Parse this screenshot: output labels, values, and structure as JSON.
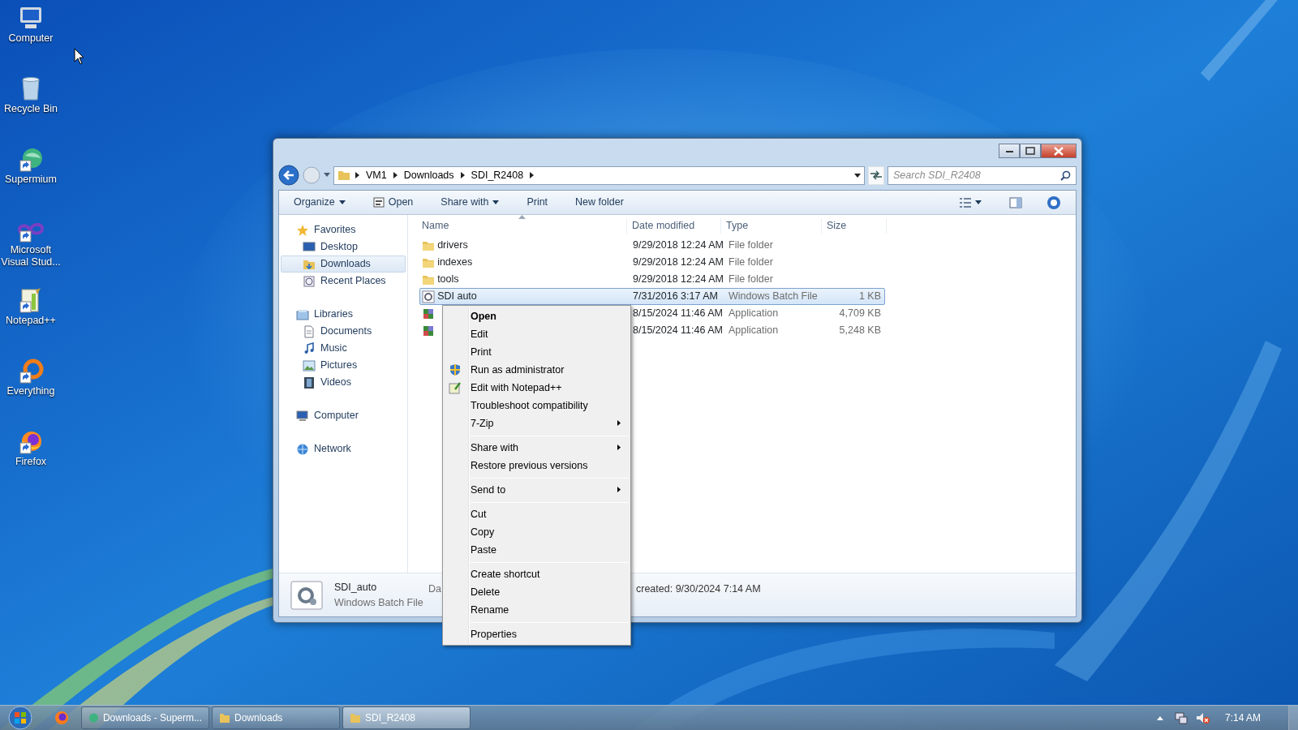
{
  "desktop_icons": [
    {
      "label": "Computer",
      "kind": "computer"
    },
    {
      "label": "Recycle Bin",
      "kind": "bin"
    },
    {
      "label": "Supermium",
      "kind": "sphere"
    },
    {
      "label": "Microsoft Visual Stud...",
      "kind": "infinity"
    },
    {
      "label": "Notepad++",
      "kind": "editor"
    },
    {
      "label": "Everything",
      "kind": "ring"
    },
    {
      "label": "Firefox",
      "kind": "fox"
    }
  ],
  "window": {
    "address": {
      "breadcrumb": [
        "VM1",
        "Downloads",
        "SDI_R2408"
      ]
    },
    "search": {
      "placeholder": "Search SDI_R2408"
    },
    "toolbar": [
      {
        "label": "Organize",
        "kind": "menu"
      },
      {
        "label": "Open",
        "kind": "open"
      },
      {
        "label": "Share with",
        "kind": "menu"
      },
      {
        "label": "Print",
        "kind": "plain"
      },
      {
        "label": "New folder",
        "kind": "plain"
      }
    ],
    "nav": [
      {
        "label": "Favorites",
        "kind": "star",
        "selected": false,
        "children": [
          {
            "label": "Desktop",
            "kind": "desktop",
            "selected": false
          },
          {
            "label": "Downloads",
            "kind": "downloads",
            "selected": true
          },
          {
            "label": "Recent Places",
            "kind": "recent",
            "selected": false
          }
        ]
      },
      {
        "label": "Libraries",
        "kind": "libraries",
        "selected": false,
        "children": [
          {
            "label": "Documents",
            "kind": "document",
            "selected": false
          },
          {
            "label": "Music",
            "kind": "music",
            "selected": false
          },
          {
            "label": "Pictures",
            "kind": "pictures",
            "selected": false
          },
          {
            "label": "Videos",
            "kind": "videos",
            "selected": false
          }
        ]
      },
      {
        "label": "Computer",
        "kind": "computer",
        "selected": false
      },
      {
        "label": "Network",
        "kind": "network",
        "selected": false
      }
    ],
    "columns": [
      "Name",
      "Date modified",
      "Type",
      "Size"
    ],
    "rows": [
      {
        "name": "drivers",
        "date": "9/29/2018 12:24 AM",
        "type": "File folder",
        "kind": "folder",
        "selected": false
      },
      {
        "name": "indexes",
        "date": "9/29/2018 12:24 AM",
        "type": "File folder",
        "kind": "folder",
        "selected": false
      },
      {
        "name": "tools",
        "date": "9/29/2018 12:24 AM",
        "type": "File folder",
        "kind": "folder",
        "selected": false
      },
      {
        "name": "SDI auto",
        "date": "7/31/2016 3:17 AM",
        "type": "Windows Batch File",
        "size": "1 KB",
        "kind": "batch",
        "selected": true
      },
      {
        "date": "8/15/2024 11:46 AM",
        "type": "Application",
        "size": "4,709 KB",
        "kind": "app",
        "selected": false
      },
      {
        "date": "8/15/2024 11:46 AM",
        "type": "Application",
        "size": "5,248 KB",
        "kind": "app",
        "selected": false
      }
    ],
    "details": {
      "name": "SDI_auto",
      "type": "Windows Batch File",
      "field_1": "Da",
      "field_2": "created: 9/30/2024 7:14 AM"
    }
  },
  "context_menu": [
    {
      "label": "Open",
      "kind": "item",
      "default": true
    },
    {
      "label": "Edit",
      "kind": "item"
    },
    {
      "label": "Print",
      "kind": "item"
    },
    {
      "label": "Run as administrator",
      "kind": "admin"
    },
    {
      "label": "Edit with Notepad++",
      "kind": "editor"
    },
    {
      "label": "Troubleshoot compatibility",
      "kind": "item"
    },
    {
      "label": "7-Zip",
      "kind": "item",
      "submenu": true
    },
    {
      "kind": "separator"
    },
    {
      "label": "Share with",
      "kind": "item",
      "submenu": true
    },
    {
      "label": "Restore previous versions",
      "kind": "item"
    },
    {
      "kind": "separator"
    },
    {
      "label": "Send to",
      "kind": "item",
      "submenu": true
    },
    {
      "kind": "separator"
    },
    {
      "label": "Cut",
      "kind": "item"
    },
    {
      "label": "Copy",
      "kind": "item"
    },
    {
      "label": "Paste",
      "kind": "item"
    },
    {
      "kind": "separator"
    },
    {
      "label": "Create shortcut",
      "kind": "item"
    },
    {
      "label": "Delete",
      "kind": "item"
    },
    {
      "label": "Rename",
      "kind": "item"
    },
    {
      "kind": "separator"
    },
    {
      "label": "Properties",
      "kind": "item"
    }
  ],
  "taskbar": {
    "buttons": [
      {
        "label": "Downloads - Superm...",
        "kind": "browser",
        "selected": false
      },
      {
        "label": "Downloads",
        "kind": "folder",
        "selected": false
      },
      {
        "label": "SDI_R2408",
        "kind": "folder",
        "selected": true
      }
    ],
    "clock": "7:14 AM"
  }
}
